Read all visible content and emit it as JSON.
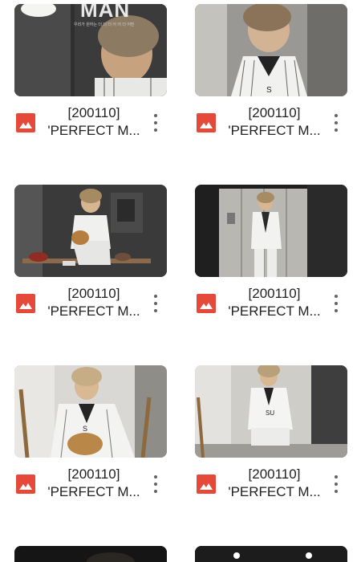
{
  "files": [
    {
      "title_line1": "[200110]",
      "title_line2": "'PERFECT M...",
      "thumb_scene": "portrait-lamp",
      "icon": "image-file-icon"
    },
    {
      "title_line1": "[200110]",
      "title_line2": "'PERFECT M...",
      "thumb_scene": "portrait-pinstripe",
      "icon": "image-file-icon"
    },
    {
      "title_line1": "[200110]",
      "title_line2": "'PERFECT M...",
      "thumb_scene": "seated-bench",
      "icon": "image-file-icon"
    },
    {
      "title_line1": "[200110]",
      "title_line2": "'PERFECT M...",
      "thumb_scene": "standing-lockers",
      "icon": "image-file-icon"
    },
    {
      "title_line1": "[200110]",
      "title_line2": "'PERFECT M...",
      "thumb_scene": "crouch-glove",
      "icon": "image-file-icon"
    },
    {
      "title_line1": "[200110]",
      "title_line2": "'PERFECT M...",
      "thumb_scene": "crouch-wall",
      "icon": "image-file-icon"
    }
  ],
  "thumb1_overlay": {
    "headline": "MAN",
    "caption": "우리가 원하는 더 더 더 어 어 더 어떤"
  },
  "colors": {
    "image_icon": "#e5493a",
    "title_text": "#222222",
    "more_dots": "#5f6368"
  }
}
